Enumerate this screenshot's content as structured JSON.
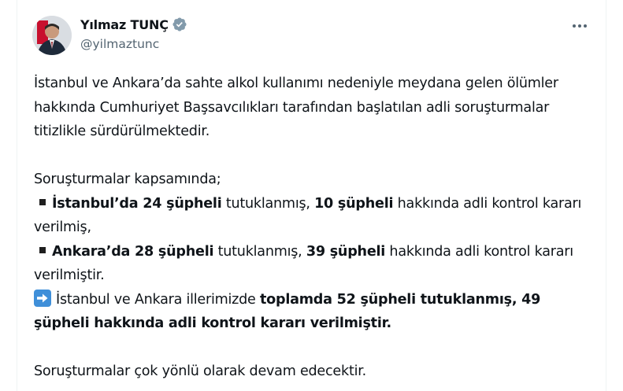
{
  "author": {
    "display_name": "Yılmaz TUNÇ",
    "handle": "@yilmaztunc"
  },
  "icons": {
    "verified": "verified-badge-icon",
    "more": "more-options-icon",
    "bullet": "black-square-bullet-icon",
    "arrow": "right-arrow-emoji-icon"
  },
  "colors": {
    "verified_badge": "#829aab",
    "handle_text": "#536471",
    "arrow_emoji": "#3f8fd9"
  },
  "tweet": {
    "paragraph1": "İstanbul ve Ankara’da sahte alkol kullanımı nedeniyle meydana gelen ölümler hakkında Cumhuriyet Başsavcılıkları tarafından başlatılan adli soruşturmalar titizlikle sürdürülmektedir.",
    "intro": "Soruşturmalar kapsamında;",
    "item1": {
      "bold_a": "İstanbul’da 24 şüpheli",
      "text_a": " tutuklanmış, ",
      "bold_b": "10 şüpheli",
      "text_b": " hakkında adli kontrol kararı verilmiş,"
    },
    "item2": {
      "bold_a": "Ankara’da 28 şüpheli",
      "text_a": " tutuklanmış, ",
      "bold_b": "39 şüpheli",
      "text_b": " hakkında adli kontrol kararı verilmiştir."
    },
    "summary": {
      "text_a": "İstanbul ve Ankara illerimizde ",
      "bold_a": "toplamda 52 şüpheli tutuklanmış, 49 şüpheli hakkında adli kontrol kararı verilmiştir."
    },
    "closing": "Soruşturmalar çok yönlü olarak devam edecektir."
  }
}
